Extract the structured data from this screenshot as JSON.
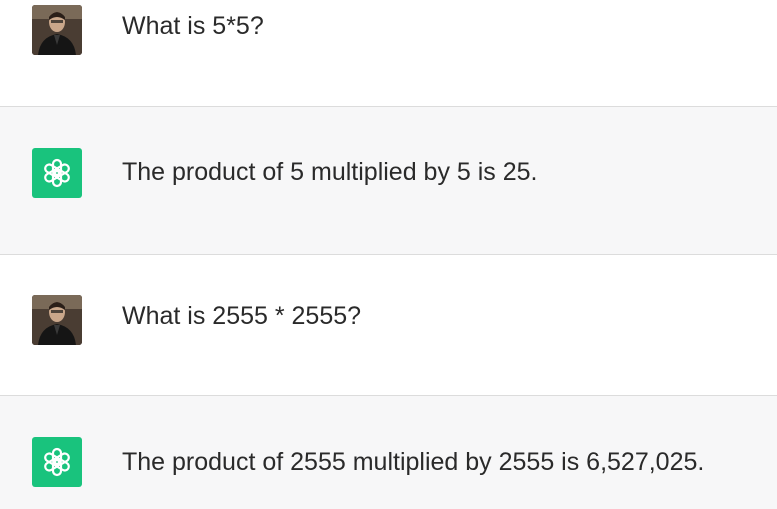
{
  "conversation": [
    {
      "role": "user",
      "text": "What is 5*5?",
      "avatar": "user-photo"
    },
    {
      "role": "assistant",
      "text": "The product of 5 multiplied by 5 is 25.",
      "avatar": "openai-logo-icon"
    },
    {
      "role": "user",
      "text": "What is 2555 * 2555?",
      "avatar": "user-photo"
    },
    {
      "role": "assistant",
      "text": "The product of 2555 multiplied by 2555 is 6,527,025.",
      "avatar": "openai-logo-icon"
    }
  ],
  "colors": {
    "assistant_bg": "#f7f7f8",
    "user_bg": "#ffffff",
    "brand_green": "#19c37d",
    "text": "#2a2a2a",
    "divider": "#dcdcdc"
  }
}
